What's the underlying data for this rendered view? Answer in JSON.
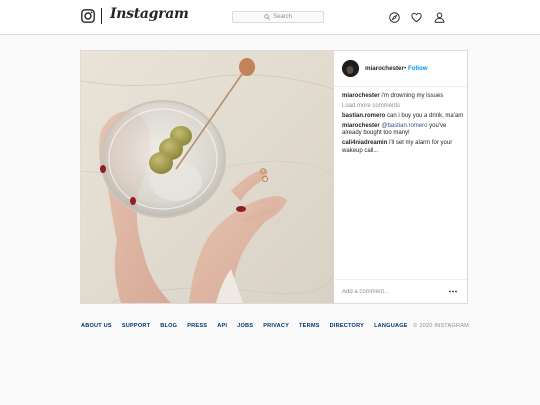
{
  "header": {
    "brand": "Instagram",
    "search": {
      "placeholder": "Search"
    },
    "icons": [
      "camera-icon",
      "search-icon",
      "compass-icon",
      "heart-icon",
      "profile-icon"
    ]
  },
  "post": {
    "owner": "miarochester",
    "separator": "•",
    "follow_label": "Follow",
    "caption": {
      "user": "miarochester",
      "text": "i'm drowning my issues"
    },
    "load_more": "Load more comments",
    "comments": [
      {
        "user": "bastian.romero",
        "text": "can i buy you a drink, ma'am"
      },
      {
        "user": "miarochester",
        "mention": "@bastian.romero",
        "text": "you've already bought too many!"
      },
      {
        "user": "cali4niadreamin",
        "text": "i'll set my alarm for your wakeup call..."
      }
    ],
    "add_comment_placeholder": "Add a comment...",
    "more_icon": "more-options-icon"
  },
  "footer": {
    "links": [
      "ABOUT US",
      "SUPPORT",
      "BLOG",
      "PRESS",
      "API",
      "JOBS",
      "PRIVACY",
      "TERMS",
      "DIRECTORY",
      "LANGUAGE"
    ],
    "copyright": "© 2020 INSTAGRAM"
  },
  "colors": {
    "accent": "#0095f6",
    "link": "#00376b",
    "border": "#dbdbdb",
    "muted": "#8e8e8e",
    "text": "#262626"
  }
}
